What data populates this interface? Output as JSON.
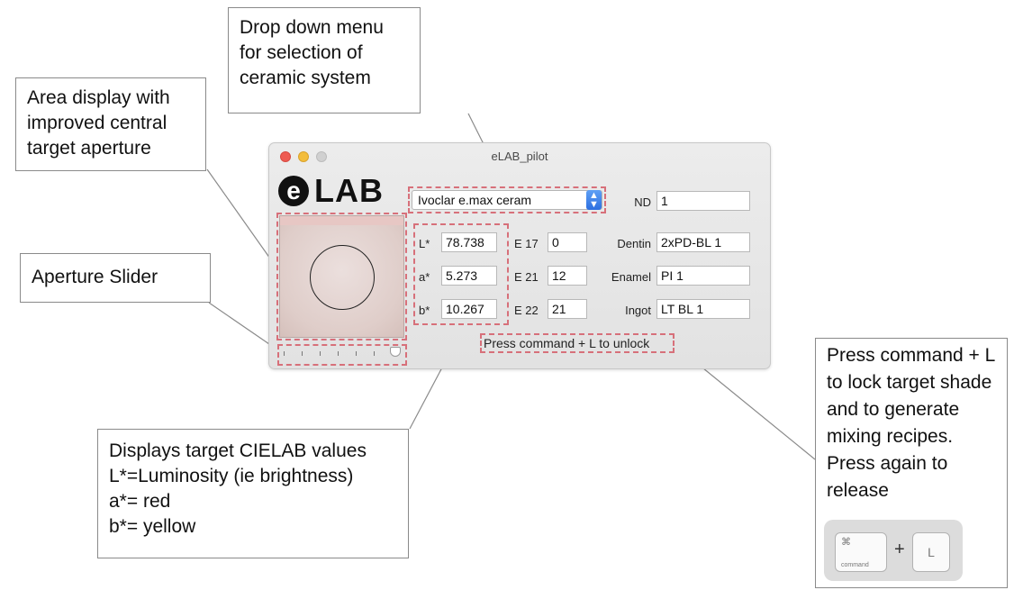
{
  "callouts": {
    "dropdown": [
      "Drop down menu",
      "for selection of",
      "ceramic system"
    ],
    "area": [
      "Area display with",
      "improved central",
      "target aperture"
    ],
    "slider": [
      "Aperture Slider"
    ],
    "cielab": [
      "Displays target CIELAB values",
      "L*=Luminosity (ie brightness)",
      "a*= red",
      "b*= yellow"
    ],
    "lock": [
      "Press command + L",
      "to lock target shade",
      "and to generate",
      "mixing recipes.",
      "Press again to",
      "release"
    ]
  },
  "window": {
    "title": "eLAB_pilot",
    "logo_mark": "e",
    "logo_text": "LAB",
    "ceramic_select": "Ivoclar e.max ceram",
    "lab": [
      {
        "label": "L*",
        "value": "78.738"
      },
      {
        "label": "a*",
        "value": "5.273"
      },
      {
        "label": "b*",
        "value": "10.267"
      }
    ],
    "e_fields": [
      {
        "label": "E 17",
        "value": "0"
      },
      {
        "label": "E 21",
        "value": "12"
      },
      {
        "label": "E 22",
        "value": "21"
      }
    ],
    "recipe": [
      {
        "label": "ND",
        "value": "1"
      },
      {
        "label": "Dentin",
        "value": "2xPD-BL 1"
      },
      {
        "label": "Enamel",
        "value": "PI 1"
      },
      {
        "label": "Ingot",
        "value": "LT BL 1"
      }
    ],
    "unlock_text": "Press command + L to unlock"
  },
  "keys": {
    "command_symbol": "⌘",
    "command_word": "command",
    "plus": "+",
    "l": "L"
  },
  "colors": {
    "dash_highlight": "#d7707a",
    "select_accent": "#2d6fe0",
    "close": "#ee5b52",
    "minimize": "#f3bd3c"
  }
}
